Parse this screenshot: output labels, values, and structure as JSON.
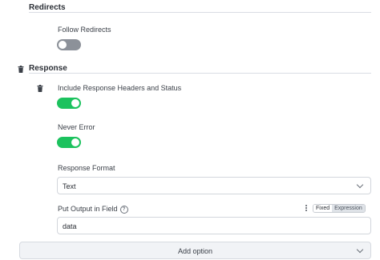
{
  "redirects": {
    "title": "Redirects",
    "follow_redirects": {
      "label": "Follow Redirects",
      "enabled": false
    }
  },
  "response": {
    "title": "Response",
    "include_headers": {
      "label": "Include Response Headers and Status",
      "enabled": true
    },
    "never_error": {
      "label": "Never Error",
      "enabled": true
    },
    "response_format": {
      "label": "Response Format",
      "value": "Text"
    },
    "put_output": {
      "label": "Put Output in Field",
      "value": "data",
      "mode_fixed": "Fixed",
      "mode_expression": "Expression"
    }
  },
  "add_option": {
    "label": "Add option"
  },
  "colors": {
    "toggle_on": "#1cc25e",
    "toggle_off": "#8c9199"
  }
}
